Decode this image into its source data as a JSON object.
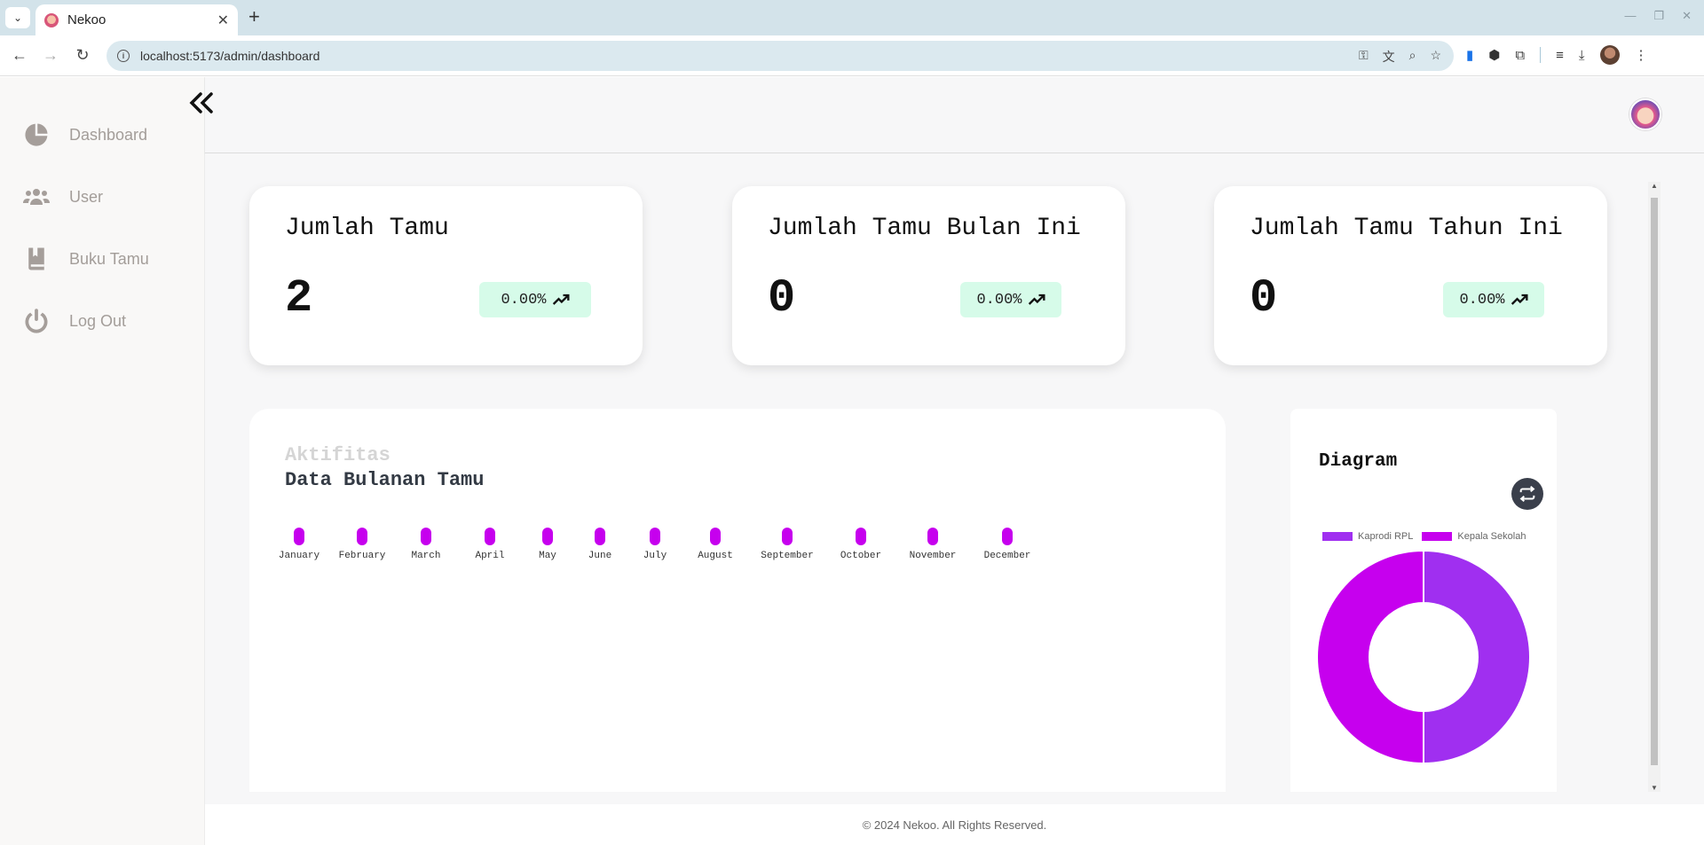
{
  "browser": {
    "tab_title": "Nekoo",
    "url": "localhost:5173/admin/dashboard"
  },
  "sidebar": {
    "items": [
      {
        "label": "Dashboard",
        "icon": "pie-chart-icon"
      },
      {
        "label": "User",
        "icon": "users-icon"
      },
      {
        "label": "Buku Tamu",
        "icon": "book-icon"
      },
      {
        "label": "Log Out",
        "icon": "power-icon"
      }
    ]
  },
  "stats": [
    {
      "title": "Jumlah Tamu",
      "value": "2",
      "change": "0.00%"
    },
    {
      "title": "Jumlah Tamu Bulan Ini",
      "value": "0",
      "change": "0.00%"
    },
    {
      "title": "Jumlah Tamu Tahun Ini",
      "value": "0",
      "change": "0.00%"
    }
  ],
  "activity": {
    "subtitle": "Aktifitas",
    "title": "Data Bulanan Tamu"
  },
  "diagram": {
    "title": "Diagram"
  },
  "footer": {
    "text": "© 2024 Nekoo. All Rights Reserved."
  },
  "colors": {
    "bar": "#c600ee",
    "slice_kaprodi": "#a02ff0",
    "slice_kepala": "#c600ee",
    "badge_bg": "#d6fbe9"
  },
  "chart_data": [
    {
      "type": "bar",
      "categories": [
        "January",
        "February",
        "March",
        "April",
        "May",
        "June",
        "July",
        "August",
        "September",
        "October",
        "November",
        "December"
      ],
      "values": [
        0,
        0,
        0,
        0,
        0,
        0,
        0,
        0,
        0,
        0,
        0,
        0
      ]
    },
    {
      "type": "pie",
      "legend": [
        "Kaprodi RPL",
        "Kepala Sekolah"
      ],
      "values": [
        1,
        1
      ]
    }
  ]
}
